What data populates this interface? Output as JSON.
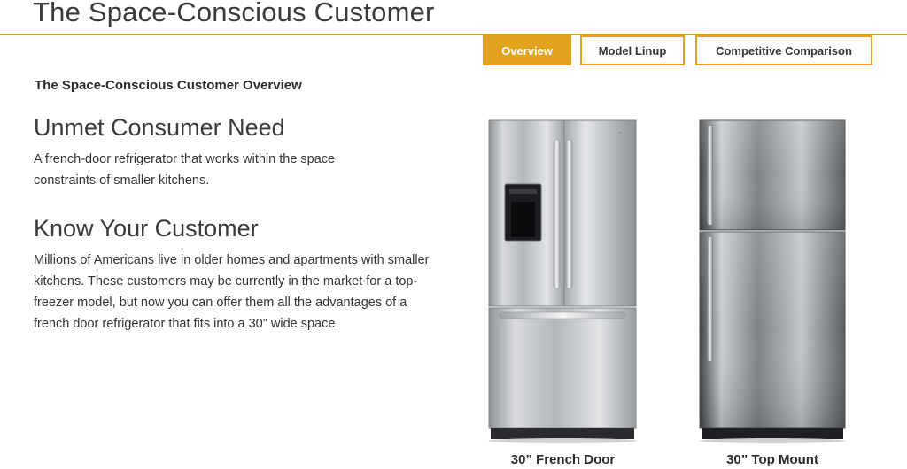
{
  "page": {
    "title": "The Space-Conscious Customer"
  },
  "tabs": [
    {
      "label": "Overview",
      "active": true
    },
    {
      "label": "Model Linup",
      "active": false
    },
    {
      "label": "Competitive Comparison",
      "active": false
    }
  ],
  "content": {
    "overview_heading": "The Space-Conscious Customer Overview",
    "sections": [
      {
        "heading": "Unmet Consumer Need",
        "text": "A french-door refrigerator that works within the space constraints of smaller kitchens."
      },
      {
        "heading": "Know Your Customer",
        "text": "Millions of Americans live in older homes and apartments with smaller kitchens. These customers may be currently in the market for a top-freezer model, but now you can offer them all the advantages of a french door refrigerator that fits into a 30\" wide space."
      }
    ]
  },
  "products": [
    {
      "caption": "30” French Door",
      "image": "french-door-refrigerator-image"
    },
    {
      "caption": "30” Top Mount",
      "image": "top-mount-refrigerator-image"
    }
  ],
  "colors": {
    "accent": "#e3a31f",
    "rule": "#d9a21b",
    "text": "#333333"
  }
}
